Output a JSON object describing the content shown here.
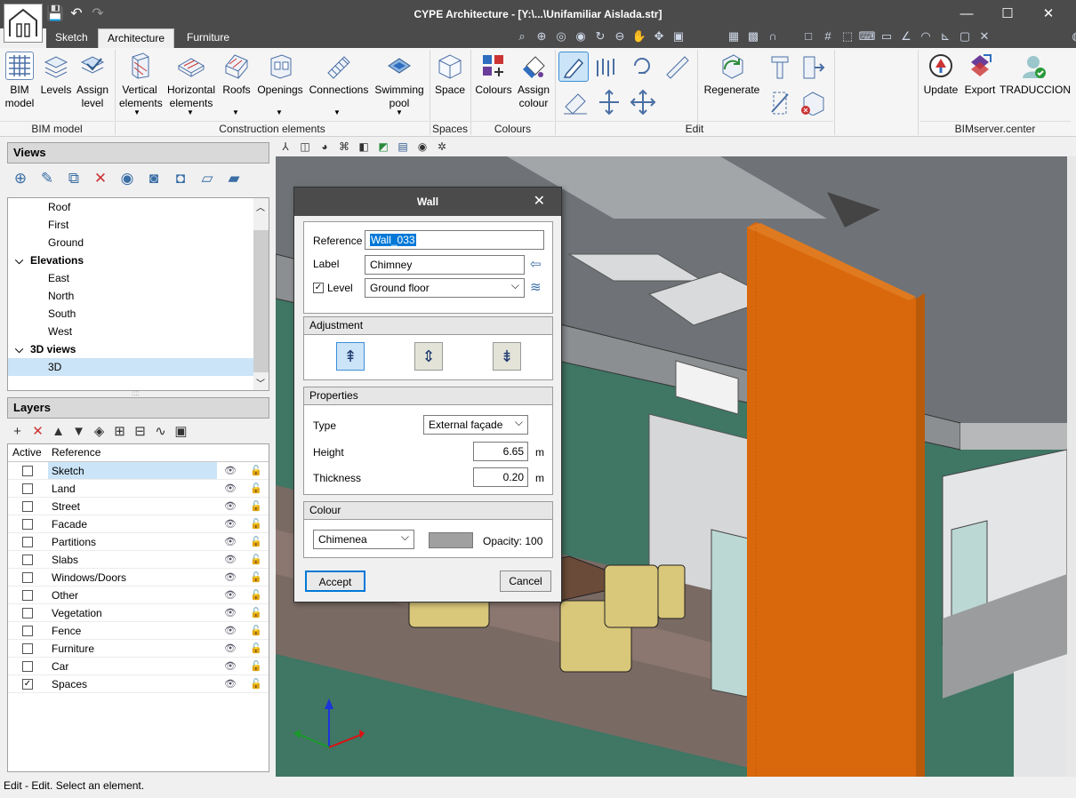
{
  "window": {
    "title": "CYPE Architecture - [Y:\\...\\Unifamiliar Aislada.str]",
    "controls": [
      "—",
      "☐",
      "✕"
    ]
  },
  "quick_access": [
    "💾",
    "↶",
    "↷"
  ],
  "tabs": [
    "Sketch",
    "Architecture",
    "Furniture"
  ],
  "active_tab": "Architecture",
  "ribbon": {
    "bim_model": {
      "label": "BIM\nmodel"
    },
    "levels": {
      "label": "Levels"
    },
    "assign_level": {
      "label": "Assign\nlevel"
    },
    "vertical_elements": {
      "label": "Vertical\nelements"
    },
    "horizontal_elements": {
      "label": "Horizontal\nelements"
    },
    "roofs": {
      "label": "Roofs"
    },
    "openings": {
      "label": "Openings"
    },
    "connections": {
      "label": "Connections"
    },
    "swimming_pool": {
      "label": "Swimming\npool"
    },
    "space": {
      "label": "Space"
    },
    "colours": {
      "label": "Colours"
    },
    "assign_colour": {
      "label": "Assign\ncolour"
    },
    "regenerate": {
      "label": "Regenerate"
    },
    "update": {
      "label": "Update"
    },
    "export": {
      "label": "Export"
    },
    "traduccion": {
      "label": "TRADUCCION"
    },
    "groups": {
      "bim_model": "BIM model",
      "construction": "Construction elements",
      "spaces": "Spaces",
      "colours": "Colours",
      "edit": "Edit",
      "bimserver": "BIMserver.center"
    }
  },
  "views": {
    "header": "Views",
    "items": [
      {
        "label": "Roof",
        "type": "item"
      },
      {
        "label": "First",
        "type": "item"
      },
      {
        "label": "Ground",
        "type": "item"
      },
      {
        "label": "Elevations",
        "type": "group"
      },
      {
        "label": "East",
        "type": "item"
      },
      {
        "label": "North",
        "type": "item"
      },
      {
        "label": "South",
        "type": "item"
      },
      {
        "label": "West",
        "type": "item"
      },
      {
        "label": "3D views",
        "type": "group"
      },
      {
        "label": "3D",
        "type": "item",
        "selected": true
      }
    ]
  },
  "layers": {
    "header": "Layers",
    "col_active": "Active",
    "col_reference": "Reference",
    "rows": [
      {
        "name": "Sketch",
        "active": false
      },
      {
        "name": "Land",
        "active": false
      },
      {
        "name": "Street",
        "active": false
      },
      {
        "name": "Facade",
        "active": false
      },
      {
        "name": "Partitions",
        "active": false
      },
      {
        "name": "Slabs",
        "active": false
      },
      {
        "name": "Windows/Doors",
        "active": false
      },
      {
        "name": "Other",
        "active": false
      },
      {
        "name": "Vegetation",
        "active": false
      },
      {
        "name": "Fence",
        "active": false
      },
      {
        "name": "Furniture",
        "active": false
      },
      {
        "name": "Car",
        "active": false
      },
      {
        "name": "Spaces",
        "active": true
      }
    ]
  },
  "dialog": {
    "title": "Wall",
    "reference_label": "Reference",
    "reference_value": "Wall_033",
    "label_label": "Label",
    "label_value": "Chimney",
    "level_label": "Level",
    "level_checked": true,
    "level_value": "Ground floor",
    "adjustment_title": "Adjustment",
    "properties_title": "Properties",
    "type_label": "Type",
    "type_value": "External façade",
    "height_label": "Height",
    "height_value": "6.65",
    "height_unit": "m",
    "thickness_label": "Thickness",
    "thickness_value": "0.20",
    "thickness_unit": "m",
    "colour_title": "Colour",
    "colour_value": "Chimenea",
    "colour_swatch": "#a0a0a0",
    "opacity_text": "Opacity: 100",
    "accept": "Accept",
    "cancel": "Cancel"
  },
  "status": "Edit - Edit. Select an element.",
  "colors": {
    "titlebar": "#4b4b4b",
    "selection": "#cce4f7",
    "wall_orange": "#d9680c"
  }
}
